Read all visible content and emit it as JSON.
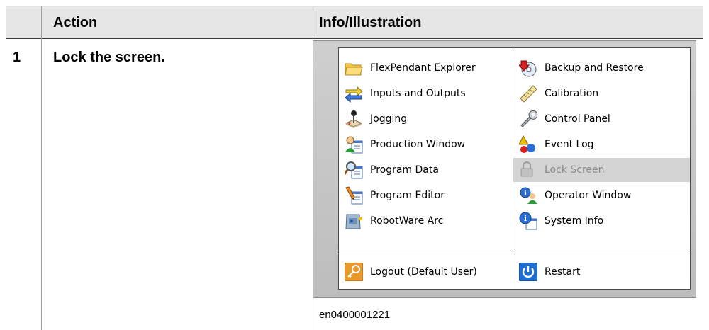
{
  "table": {
    "headers": [
      "",
      "Action",
      "Info/Illustration"
    ],
    "rows": [
      {
        "num": "1",
        "action": "Lock the screen.",
        "caption": "en0400001221"
      }
    ]
  },
  "panel": {
    "left_items": [
      {
        "label": "FlexPendant Explorer",
        "icon": "folder-icon"
      },
      {
        "label": "Inputs and Outputs",
        "icon": "io-arrows-icon"
      },
      {
        "label": "Jogging",
        "icon": "joystick-icon"
      },
      {
        "label": "Production Window",
        "icon": "production-icon"
      },
      {
        "label": "Program Data",
        "icon": "program-data-icon"
      },
      {
        "label": "Program Editor",
        "icon": "program-editor-icon"
      },
      {
        "label": "RobotWare Arc",
        "icon": "robotware-arc-icon"
      }
    ],
    "right_items": [
      {
        "label": "Backup and Restore",
        "icon": "backup-icon"
      },
      {
        "label": "Calibration",
        "icon": "ruler-icon"
      },
      {
        "label": "Control Panel",
        "icon": "wrench-icon"
      },
      {
        "label": "Event Log",
        "icon": "event-log-icon"
      },
      {
        "label": "Lock Screen",
        "icon": "lock-icon",
        "state": "disabled"
      },
      {
        "label": "Operator Window",
        "icon": "operator-icon"
      },
      {
        "label": "System Info",
        "icon": "info-icon"
      }
    ],
    "logout_label": "Logout (Default User)",
    "restart_label": "Restart"
  },
  "colors": {
    "header_bg": "#e6e6e6",
    "highlight_bg": "#d4d4d4",
    "restart_blue": "#1f6fd1",
    "logout_orange": "#e89a2c"
  }
}
